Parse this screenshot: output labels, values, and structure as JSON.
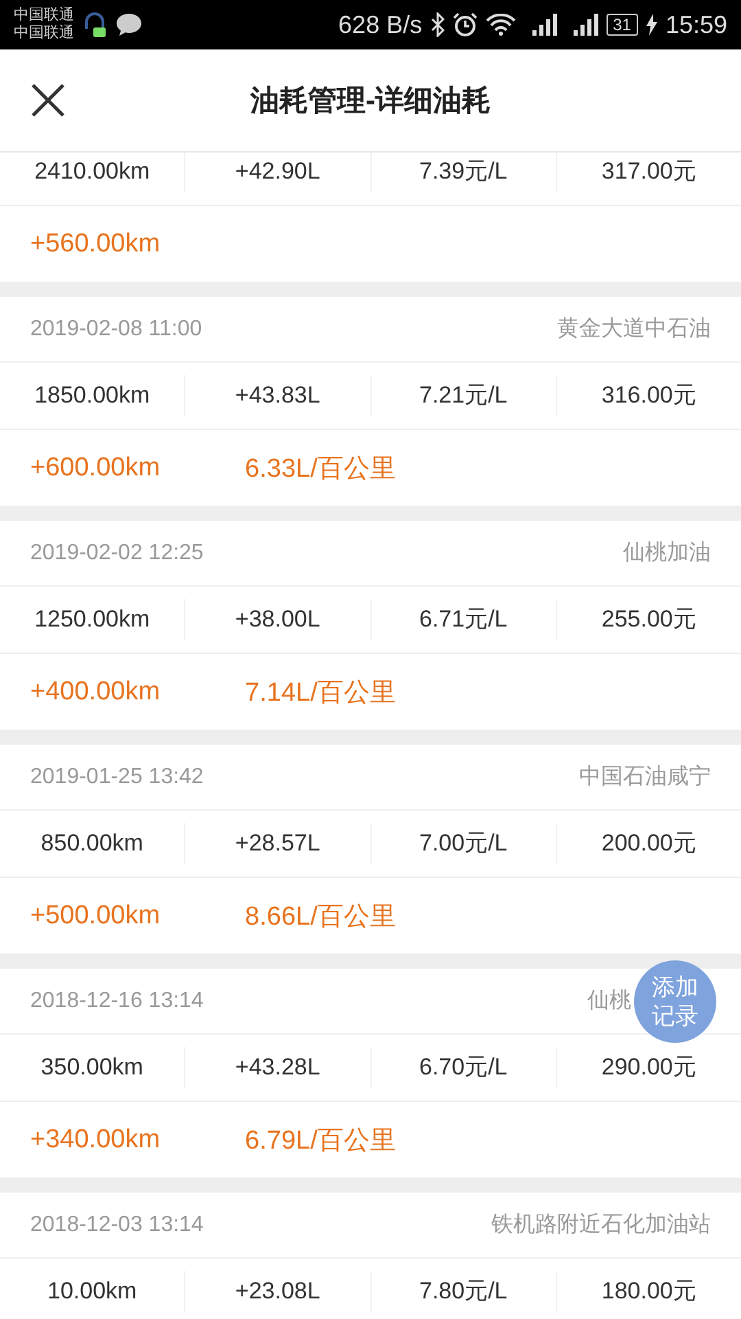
{
  "status_bar": {
    "carriers": [
      "中国联通",
      "中国联通"
    ],
    "speed": "628 B/s",
    "battery": "31",
    "time": "15:59"
  },
  "header": {
    "title": "油耗管理-详细油耗"
  },
  "records": [
    {
      "cells": [
        "2410.00km",
        "+42.90L",
        "7.39元/L",
        "317.00元"
      ],
      "distance": "+560.00km"
    },
    {
      "date": "2019-02-08 11:00",
      "station": "黄金大道中石油",
      "cells": [
        "1850.00km",
        "+43.83L",
        "7.21元/L",
        "316.00元"
      ],
      "distance": "+600.00km",
      "consumption": "6.33L/百公里"
    },
    {
      "date": "2019-02-02 12:25",
      "station": "仙桃加油",
      "cells": [
        "1250.00km",
        "+38.00L",
        "6.71元/L",
        "255.00元"
      ],
      "distance": "+400.00km",
      "consumption": "7.14L/百公里"
    },
    {
      "date": "2019-01-25 13:42",
      "station": "中国石油咸宁",
      "cells": [
        "850.00km",
        "+28.57L",
        "7.00元/L",
        "200.00元"
      ],
      "distance": "+500.00km",
      "consumption": "8.66L/百公里"
    },
    {
      "date": "2018-12-16 13:14",
      "station": "仙桃",
      "add_button": {
        "label": "添加记录"
      },
      "cells": [
        "350.00km",
        "+43.28L",
        "6.70元/L",
        "290.00元"
      ],
      "distance": "+340.00km",
      "consumption": "6.79L/百公里"
    },
    {
      "date": "2018-12-03 13:14",
      "station": "铁机路附近石化加油站",
      "cells": [
        "10.00km",
        "+23.08L",
        "7.80元/L",
        "180.00元"
      ]
    }
  ]
}
